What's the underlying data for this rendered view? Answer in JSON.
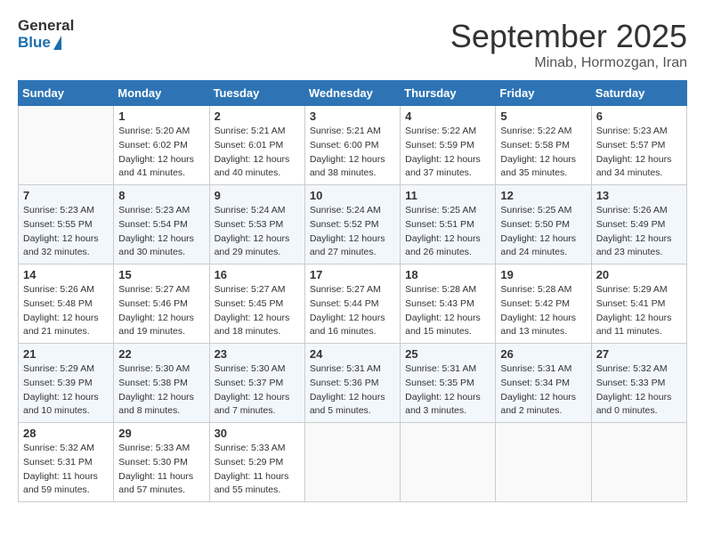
{
  "header": {
    "logo_general": "General",
    "logo_blue": "Blue",
    "month_title": "September 2025",
    "location": "Minab, Hormozgan, Iran"
  },
  "days_of_week": [
    "Sunday",
    "Monday",
    "Tuesday",
    "Wednesday",
    "Thursday",
    "Friday",
    "Saturday"
  ],
  "weeks": [
    [
      {
        "day": "",
        "empty": true
      },
      {
        "day": "1",
        "sunrise": "5:20 AM",
        "sunset": "6:02 PM",
        "daylight": "12 hours and 41 minutes."
      },
      {
        "day": "2",
        "sunrise": "5:21 AM",
        "sunset": "6:01 PM",
        "daylight": "12 hours and 40 minutes."
      },
      {
        "day": "3",
        "sunrise": "5:21 AM",
        "sunset": "6:00 PM",
        "daylight": "12 hours and 38 minutes."
      },
      {
        "day": "4",
        "sunrise": "5:22 AM",
        "sunset": "5:59 PM",
        "daylight": "12 hours and 37 minutes."
      },
      {
        "day": "5",
        "sunrise": "5:22 AM",
        "sunset": "5:58 PM",
        "daylight": "12 hours and 35 minutes."
      },
      {
        "day": "6",
        "sunrise": "5:23 AM",
        "sunset": "5:57 PM",
        "daylight": "12 hours and 34 minutes."
      }
    ],
    [
      {
        "day": "7",
        "sunrise": "5:23 AM",
        "sunset": "5:55 PM",
        "daylight": "12 hours and 32 minutes."
      },
      {
        "day": "8",
        "sunrise": "5:23 AM",
        "sunset": "5:54 PM",
        "daylight": "12 hours and 30 minutes."
      },
      {
        "day": "9",
        "sunrise": "5:24 AM",
        "sunset": "5:53 PM",
        "daylight": "12 hours and 29 minutes."
      },
      {
        "day": "10",
        "sunrise": "5:24 AM",
        "sunset": "5:52 PM",
        "daylight": "12 hours and 27 minutes."
      },
      {
        "day": "11",
        "sunrise": "5:25 AM",
        "sunset": "5:51 PM",
        "daylight": "12 hours and 26 minutes."
      },
      {
        "day": "12",
        "sunrise": "5:25 AM",
        "sunset": "5:50 PM",
        "daylight": "12 hours and 24 minutes."
      },
      {
        "day": "13",
        "sunrise": "5:26 AM",
        "sunset": "5:49 PM",
        "daylight": "12 hours and 23 minutes."
      }
    ],
    [
      {
        "day": "14",
        "sunrise": "5:26 AM",
        "sunset": "5:48 PM",
        "daylight": "12 hours and 21 minutes."
      },
      {
        "day": "15",
        "sunrise": "5:27 AM",
        "sunset": "5:46 PM",
        "daylight": "12 hours and 19 minutes."
      },
      {
        "day": "16",
        "sunrise": "5:27 AM",
        "sunset": "5:45 PM",
        "daylight": "12 hours and 18 minutes."
      },
      {
        "day": "17",
        "sunrise": "5:27 AM",
        "sunset": "5:44 PM",
        "daylight": "12 hours and 16 minutes."
      },
      {
        "day": "18",
        "sunrise": "5:28 AM",
        "sunset": "5:43 PM",
        "daylight": "12 hours and 15 minutes."
      },
      {
        "day": "19",
        "sunrise": "5:28 AM",
        "sunset": "5:42 PM",
        "daylight": "12 hours and 13 minutes."
      },
      {
        "day": "20",
        "sunrise": "5:29 AM",
        "sunset": "5:41 PM",
        "daylight": "12 hours and 11 minutes."
      }
    ],
    [
      {
        "day": "21",
        "sunrise": "5:29 AM",
        "sunset": "5:39 PM",
        "daylight": "12 hours and 10 minutes."
      },
      {
        "day": "22",
        "sunrise": "5:30 AM",
        "sunset": "5:38 PM",
        "daylight": "12 hours and 8 minutes."
      },
      {
        "day": "23",
        "sunrise": "5:30 AM",
        "sunset": "5:37 PM",
        "daylight": "12 hours and 7 minutes."
      },
      {
        "day": "24",
        "sunrise": "5:31 AM",
        "sunset": "5:36 PM",
        "daylight": "12 hours and 5 minutes."
      },
      {
        "day": "25",
        "sunrise": "5:31 AM",
        "sunset": "5:35 PM",
        "daylight": "12 hours and 3 minutes."
      },
      {
        "day": "26",
        "sunrise": "5:31 AM",
        "sunset": "5:34 PM",
        "daylight": "12 hours and 2 minutes."
      },
      {
        "day": "27",
        "sunrise": "5:32 AM",
        "sunset": "5:33 PM",
        "daylight": "12 hours and 0 minutes."
      }
    ],
    [
      {
        "day": "28",
        "sunrise": "5:32 AM",
        "sunset": "5:31 PM",
        "daylight": "11 hours and 59 minutes."
      },
      {
        "day": "29",
        "sunrise": "5:33 AM",
        "sunset": "5:30 PM",
        "daylight": "11 hours and 57 minutes."
      },
      {
        "day": "30",
        "sunrise": "5:33 AM",
        "sunset": "5:29 PM",
        "daylight": "11 hours and 55 minutes."
      },
      {
        "day": "",
        "empty": true
      },
      {
        "day": "",
        "empty": true
      },
      {
        "day": "",
        "empty": true
      },
      {
        "day": "",
        "empty": true
      }
    ]
  ]
}
